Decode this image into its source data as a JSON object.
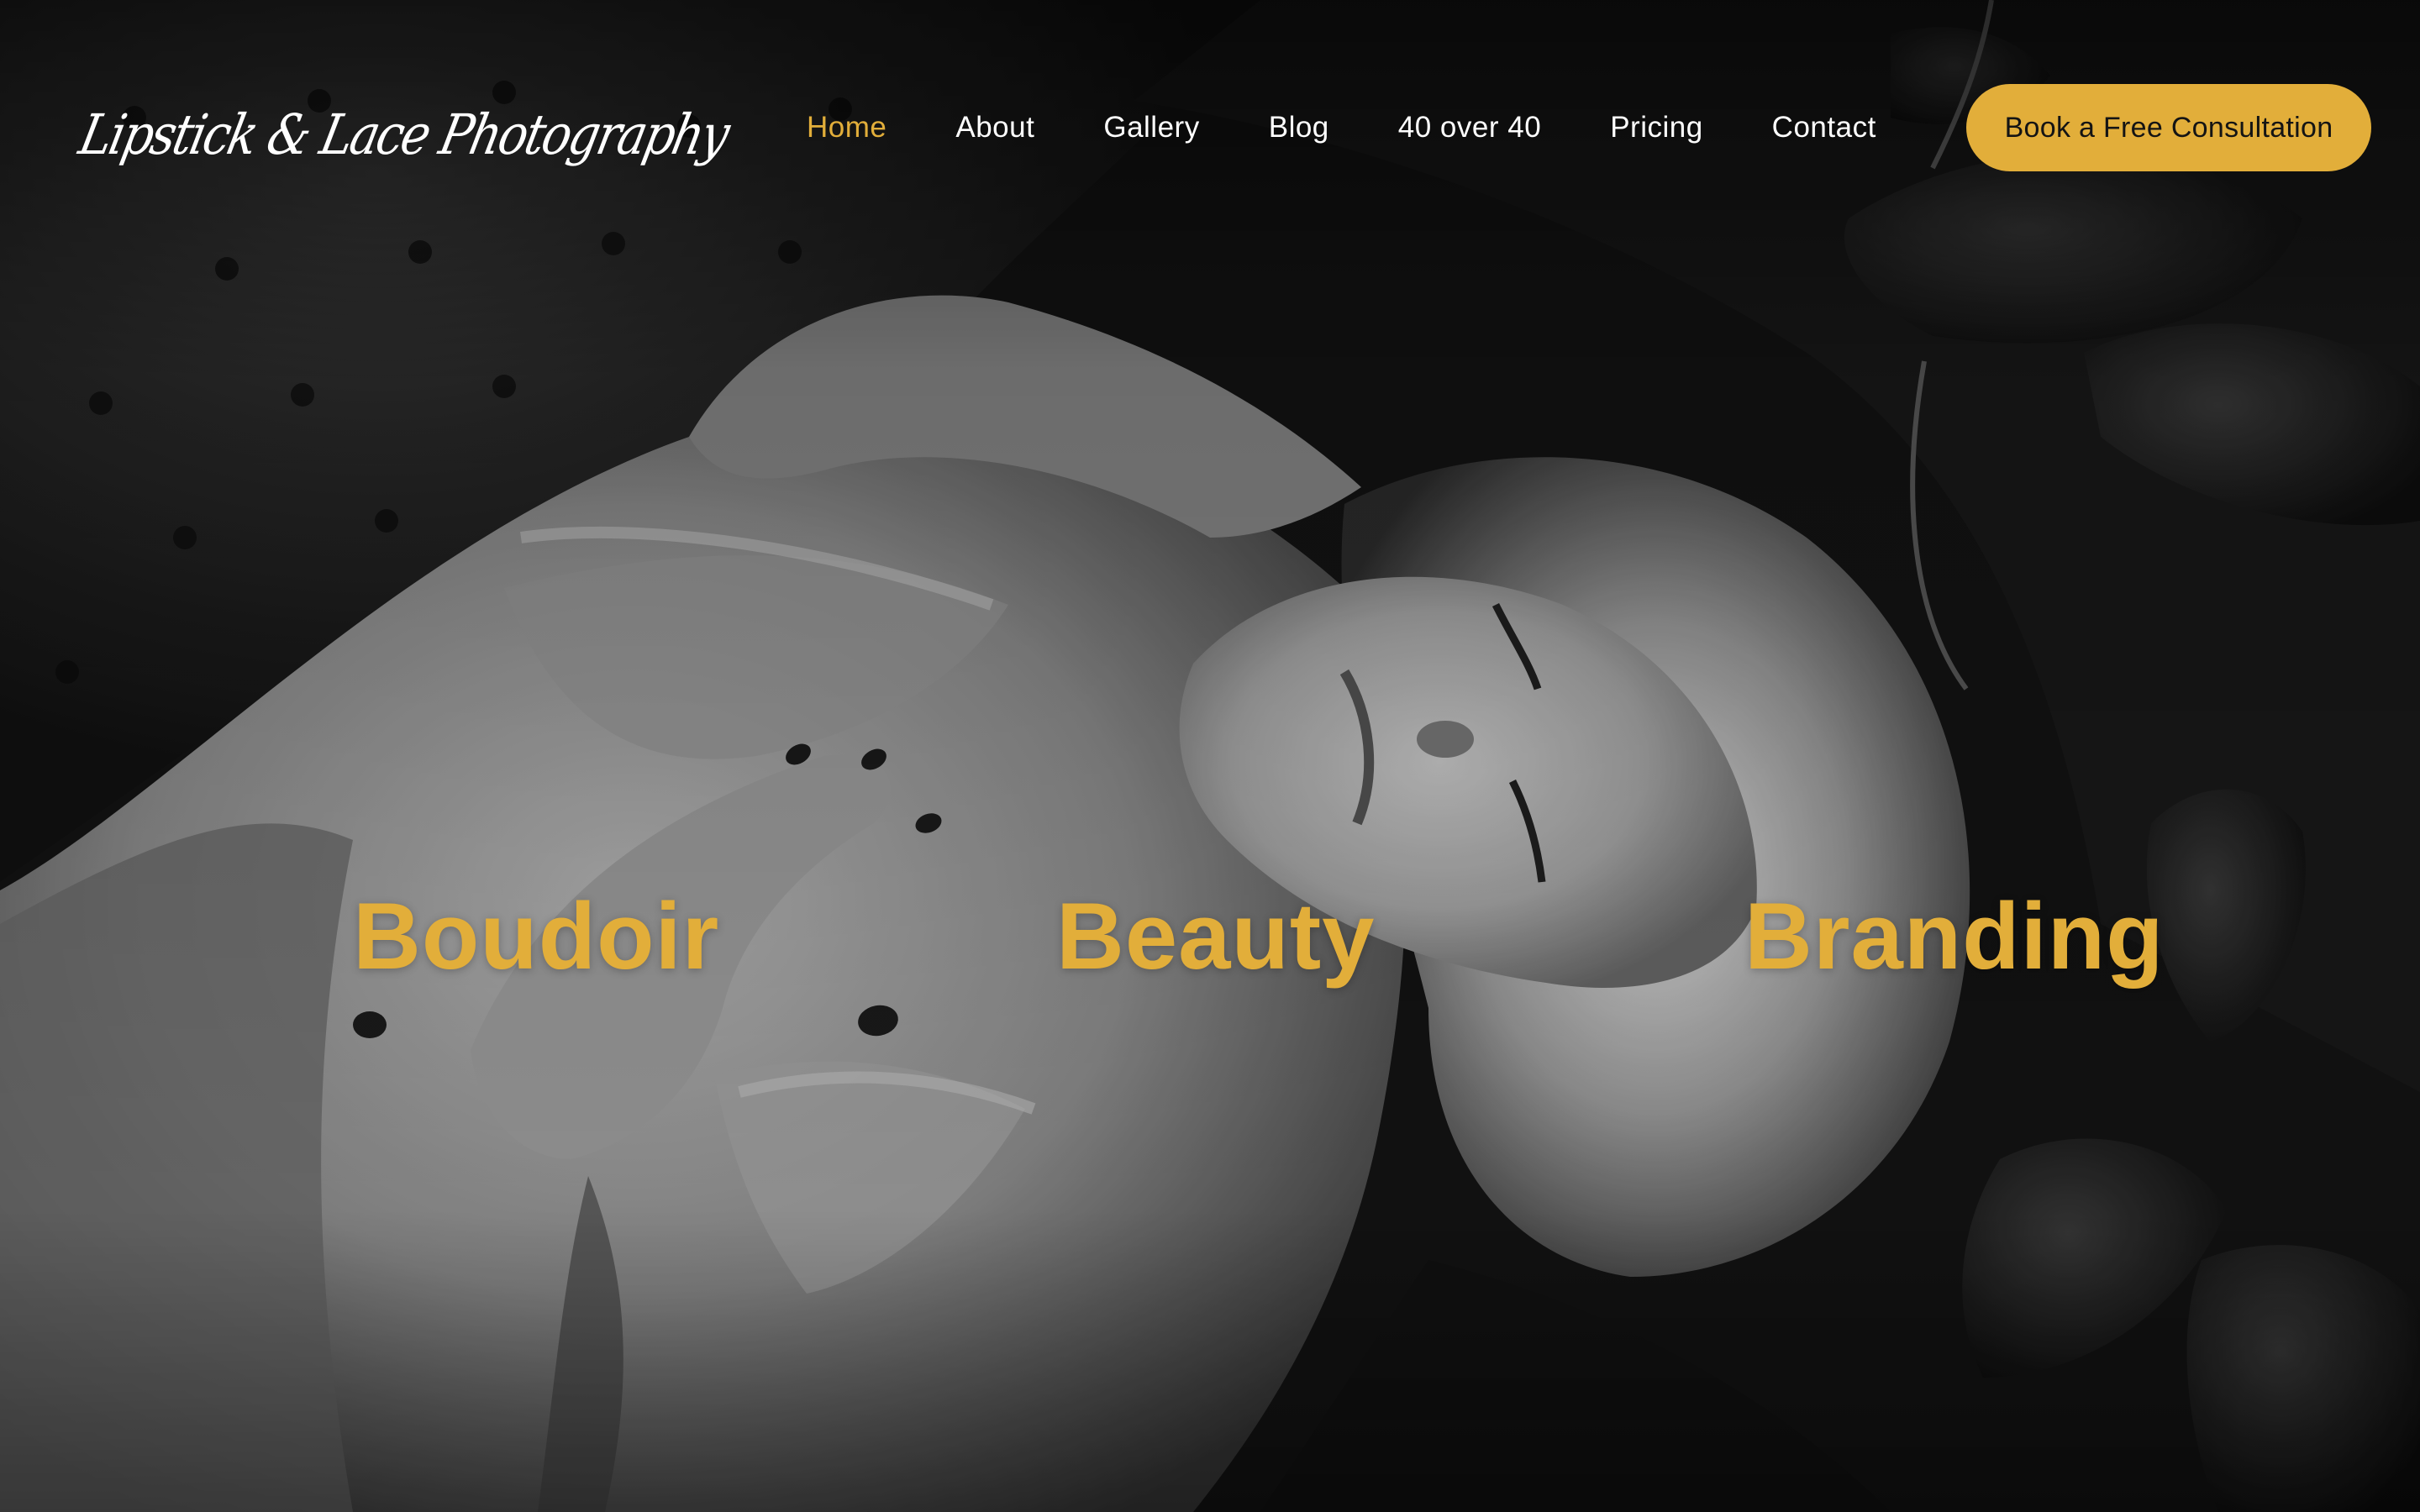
{
  "site": {
    "logo_text": "Lipstick & Lace Photography"
  },
  "nav": {
    "items": [
      {
        "label": "Home",
        "active": true
      },
      {
        "label": "About",
        "active": false
      },
      {
        "label": "Gallery",
        "active": false
      },
      {
        "label": "Blog",
        "active": false
      },
      {
        "label": "40 over 40",
        "active": false
      },
      {
        "label": "Pricing",
        "active": false
      },
      {
        "label": "Contact",
        "active": false
      }
    ],
    "cta_label": "Book a Free Consultation"
  },
  "hero": {
    "services": [
      {
        "label": "Boudoir"
      },
      {
        "label": "Beauty"
      },
      {
        "label": "Branding"
      }
    ]
  },
  "colors": {
    "accent": "#e2ae3a",
    "nav_text": "#ffffff",
    "background": "#0d0d0d"
  }
}
